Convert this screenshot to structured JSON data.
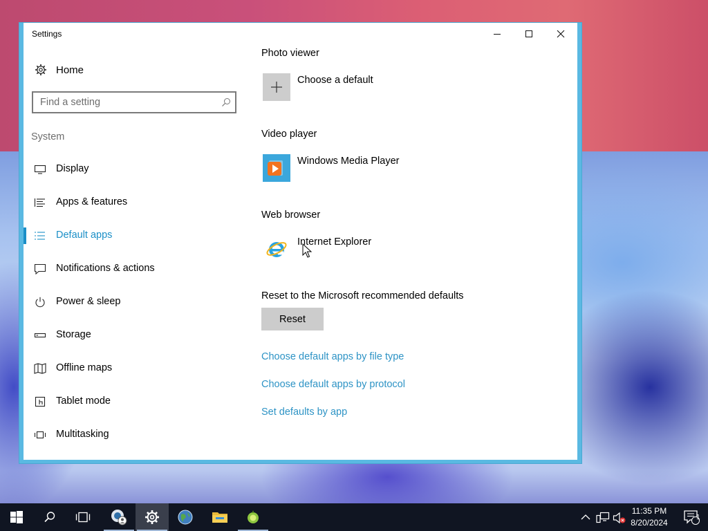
{
  "window": {
    "title": "Settings",
    "controls": {
      "minimize": "minimize-icon",
      "maximize": "maximize-icon",
      "close": "close-icon"
    }
  },
  "sidebar": {
    "home_label": "Home",
    "search_placeholder": "Find a setting",
    "section_label": "System",
    "items": [
      {
        "label": "Display",
        "icon": "display-icon",
        "active": false
      },
      {
        "label": "Apps & features",
        "icon": "apps-list-icon",
        "active": false
      },
      {
        "label": "Default apps",
        "icon": "default-apps-icon",
        "active": true
      },
      {
        "label": "Notifications & actions",
        "icon": "notification-icon",
        "active": false
      },
      {
        "label": "Power & sleep",
        "icon": "power-icon",
        "active": false
      },
      {
        "label": "Storage",
        "icon": "storage-icon",
        "active": false
      },
      {
        "label": "Offline maps",
        "icon": "map-icon",
        "active": false
      },
      {
        "label": "Tablet mode",
        "icon": "tablet-mode-icon",
        "active": false
      },
      {
        "label": "Multitasking",
        "icon": "multitasking-icon",
        "active": false
      }
    ]
  },
  "main": {
    "photo_viewer": {
      "heading": "Photo viewer",
      "app": "Choose a default",
      "icon": "plus-icon"
    },
    "video_player": {
      "heading": "Video player",
      "app": "Windows Media Player",
      "icon": "windows-media-player-icon"
    },
    "web_browser": {
      "heading": "Web browser",
      "app": "Internet Explorer",
      "icon": "internet-explorer-icon"
    },
    "reset": {
      "heading": "Reset to the Microsoft recommended defaults",
      "button": "Reset"
    },
    "links": [
      "Choose default apps by file type",
      "Choose default apps by protocol",
      "Set defaults by app"
    ]
  },
  "taskbar": {
    "apps": [
      "start-icon",
      "search-icon",
      "task-view-icon",
      "network-drive-app-icon",
      "settings-gear-icon",
      "browser-globe-icon",
      "file-explorer-icon",
      "green-app-icon"
    ],
    "tray": [
      "chevron-up-icon",
      "network-icon",
      "volume-muted-icon",
      "action-center-icon"
    ],
    "time": "11:35 PM",
    "date": "8/20/2024",
    "notification_count": "1"
  },
  "colors": {
    "accent": "#1b8fc7",
    "link": "#2d93c5",
    "window_border": "#5ab9e2",
    "taskbar": "#101522"
  }
}
